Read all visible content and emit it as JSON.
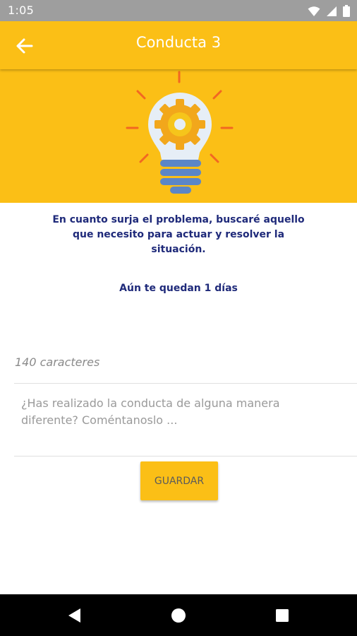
{
  "status_bar": {
    "time": "1:05",
    "icons": [
      "wifi-icon",
      "signal-icon",
      "battery-icon"
    ]
  },
  "header": {
    "title": "Conducta 3",
    "back_icon": "arrow-left-icon"
  },
  "hero": {
    "illustration": "lightbulb-gear-icon"
  },
  "content": {
    "description": "En cuanto surja el problema, buscaré aquello que necesito para actuar y resolver la situación.",
    "remaining": "Aún te quedan 1 días"
  },
  "form": {
    "char_counter": "140 caracteres",
    "comment_value": "",
    "comment_placeholder": "¿Has realizado la conducta de alguna manera diferente? Coméntanoslo ...",
    "save_label": "GUARDAR"
  },
  "nav_bar": {
    "buttons": [
      "back-triangle-icon",
      "home-circle-icon",
      "recents-square-icon"
    ]
  },
  "colors": {
    "primary": "#fbbf16",
    "text_primary": "#1f2a7a",
    "status_bar": "#9e9e9e",
    "nav_bar": "#000000"
  }
}
